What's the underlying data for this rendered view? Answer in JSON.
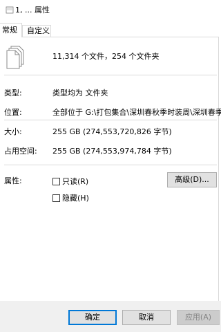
{
  "window": {
    "title": "1, ... 属性"
  },
  "tabs": [
    {
      "label": "常规",
      "active": true
    },
    {
      "label": "自定义",
      "active": false
    }
  ],
  "summary": {
    "text": "11,314 个文件，254 个文件夹"
  },
  "properties": {
    "type_label": "类型:",
    "type_value": "类型均为 文件夹",
    "location_label": "位置:",
    "location_value": "全部位于 G:\\打包集合\\深圳春秋季时装周\\深圳春季时装",
    "size_label": "大小:",
    "size_value": "255 GB (274,553,720,826 字节)",
    "disk_size_label": "占用空间:",
    "disk_size_value": "255 GB (274,553,974,784 字节)",
    "attributes_label": "属性:"
  },
  "attributes": {
    "readonly_label": "只读(R)",
    "readonly_checked": false,
    "hidden_label": "隐藏(H)",
    "hidden_checked": false,
    "advanced_button": "高级(D)..."
  },
  "footer": {
    "ok_label": "确定",
    "cancel_label": "取消",
    "apply_label": "应用(A)",
    "apply_enabled": false
  },
  "colors": {
    "accent": "#0078d7",
    "divider": "#d9d9d9",
    "footer_bg": "#f0f0f0",
    "button_bg": "#e1e1e1",
    "disabled_text": "#838383"
  },
  "icons": {
    "title_icon": "folder-icon",
    "file_icon": "multiple-files-icon"
  }
}
